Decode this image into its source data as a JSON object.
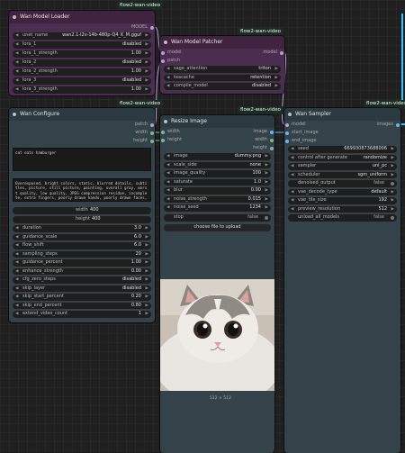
{
  "badges": {
    "loader": "flow2-wan-video",
    "patcher": "flow2-wan-video",
    "configure": "flow2-wan-video",
    "resize": "flow2-wan-video",
    "sampler": "flow2-wan-video"
  },
  "loader": {
    "title": "Wan Model Loader",
    "output": "MODEL",
    "widgets": [
      {
        "label": "unet_name",
        "value": "wan2.1-i2v-14b-480p-Q4_K_M.gguf"
      },
      {
        "label": "lora_1",
        "value": "disabled"
      },
      {
        "label": "lora_1_strength",
        "value": "1.00"
      },
      {
        "label": "lora_2",
        "value": "disabled"
      },
      {
        "label": "lora_2_strength",
        "value": "1.00"
      },
      {
        "label": "lora_3",
        "value": "disabled"
      },
      {
        "label": "lora_3_strength",
        "value": "1.00"
      }
    ]
  },
  "patcher": {
    "title": "Wan Model Patcher",
    "input": "model",
    "input2": "patch",
    "output": "model",
    "widgets": [
      {
        "label": "sage_attention",
        "value": "triton"
      },
      {
        "label": "teacache",
        "value": "retention"
      },
      {
        "label": "compile_model",
        "value": "disabled"
      }
    ]
  },
  "configure": {
    "title": "Wan Configure",
    "outputs": [
      "patch",
      "width",
      "height"
    ],
    "prompt": "cat eats hamburger",
    "negative": "Overexposed, bright colors, static, blurred details, subtitles, picture, still picture, painting, overall gray, worst quality, low quality, JPEG compression residue, incomplete, extra fingers, poorly drawn hands, poorly drawn faces, deformed, mutation, disfigured, malformed limbs, fused fingers, cluttered background, three legs, walking backwards, static frame",
    "width_label": "width",
    "width_value": "400",
    "height_label": "height",
    "height_value": "400",
    "widgets": [
      {
        "label": "duration",
        "value": "3.0"
      },
      {
        "label": "guidance_scale",
        "value": "6.0"
      },
      {
        "label": "flow_shift",
        "value": "6.0"
      },
      {
        "label": "sampling_steps",
        "value": "20"
      },
      {
        "label": "guidance_percent",
        "value": "1.00"
      },
      {
        "label": "enhance_strength",
        "value": "0.00"
      },
      {
        "label": "cfg_zero_steps",
        "value": "disabled"
      },
      {
        "label": "skip_layer",
        "value": "disabled"
      },
      {
        "label": "skip_start_percent",
        "value": "0.20"
      },
      {
        "label": "skip_end_percent",
        "value": "0.80"
      },
      {
        "label": "extend_video_count",
        "value": "1"
      }
    ]
  },
  "resize": {
    "title": "Resize Image",
    "inputs": [
      "width",
      "height"
    ],
    "outputs": [
      "image",
      "width",
      "height"
    ],
    "widgets": [
      {
        "label": "image",
        "value": "dummy.png"
      },
      {
        "label": "scale_side",
        "value": "none"
      },
      {
        "label": "image_quality",
        "value": "100"
      },
      {
        "label": "saturate",
        "value": "1.0"
      },
      {
        "label": "blur",
        "value": "0.00"
      },
      {
        "label": "noise_strength",
        "value": "0.015"
      },
      {
        "label": "noise_seed",
        "value": "1234"
      }
    ],
    "toggle": {
      "label": "stop",
      "value": "false"
    },
    "upload_button": "choose file to upload",
    "caption": "512 × 512"
  },
  "sampler": {
    "title": "Wan Sampler",
    "inputs": [
      "model",
      "start_image",
      "end_image"
    ],
    "output": "images",
    "widgets": [
      {
        "label": "seed",
        "value": "669930873688006"
      },
      {
        "label": "control after generate",
        "value": "randomize"
      },
      {
        "label": "sampler",
        "value": "uni_pc"
      },
      {
        "label": "scheduler",
        "value": "sgm_uniform"
      }
    ],
    "toggle1": {
      "label": "denoised_output",
      "value": "false"
    },
    "widgets2": [
      {
        "label": "vae_decode_type",
        "value": "default"
      },
      {
        "label": "vae_tile_size",
        "value": "192"
      },
      {
        "label": "preview_resolution",
        "value": "512"
      }
    ],
    "toggle2": {
      "label": "unload_all_models",
      "value": "false"
    }
  },
  "colors": {
    "model_wire": "#b39ddb",
    "image_wire": "#64b5f6",
    "int_wire": "#7fb69a",
    "accent": "#33c4ff"
  }
}
